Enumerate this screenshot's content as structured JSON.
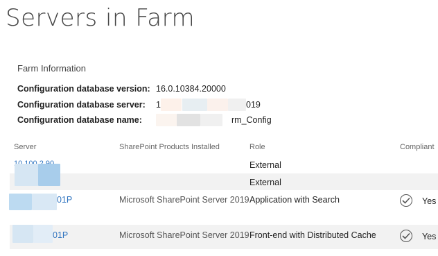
{
  "page": {
    "title": "Servers in Farm"
  },
  "farm_info": {
    "heading": "Farm Information",
    "config_db_version": {
      "label": "Configuration database version:",
      "value": "16.0.10384.20000"
    },
    "config_db_server": {
      "label": "Configuration database server:",
      "value_prefix": "1",
      "value_suffix": "019"
    },
    "config_db_name": {
      "label": "Configuration database name:",
      "value_suffix": "rm_Config"
    }
  },
  "table": {
    "columns": [
      "Server",
      "SharePoint Products Installed",
      "Role",
      "Compliant"
    ],
    "rows": [
      {
        "server": "10.100.2.90",
        "product": "",
        "role": "External",
        "compliant": ""
      },
      {
        "server": "",
        "product": "",
        "role": "External",
        "compliant": ""
      },
      {
        "server": "01P",
        "product": "Microsoft SharePoint Server 2019",
        "role": "Application with Search",
        "compliant": "Yes"
      },
      {
        "server": "01P",
        "product": "Microsoft SharePoint Server 2019",
        "role": "Front-end with Distributed Cache",
        "compliant": "Yes"
      }
    ]
  },
  "colors": {
    "link": "#2f74c0",
    "row_alt_background": "#f2f2f2",
    "redaction_light_blue": "#d6e6f3",
    "redaction_blue": "#a8cdeb"
  },
  "icons": {
    "compliant": "check-circle-icon"
  }
}
